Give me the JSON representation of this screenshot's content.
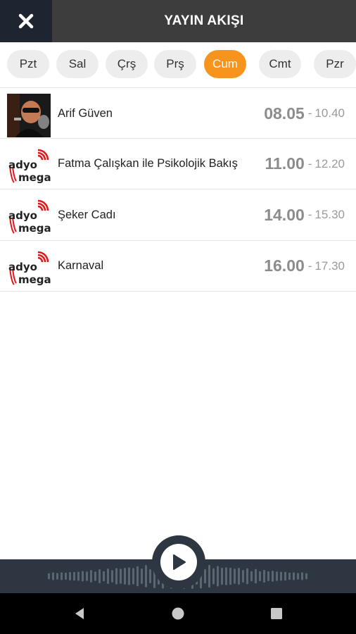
{
  "header": {
    "title": "YAYIN AKIŞI",
    "close_icon": "close-icon"
  },
  "days": [
    {
      "label": "Pzt",
      "active": false
    },
    {
      "label": "Sal",
      "active": false
    },
    {
      "label": "Çrş",
      "active": false
    },
    {
      "label": "Prş",
      "active": false
    },
    {
      "label": "Cum",
      "active": true
    },
    {
      "label": "Cmt",
      "active": false
    },
    {
      "label": "Pzr",
      "active": false
    }
  ],
  "schedule": [
    {
      "name": "Arif Güven",
      "start": "08.05",
      "end": "10.40",
      "thumb": "host-photo"
    },
    {
      "name": "Fatma Çalışkan ile Psikolojik Bakış",
      "start": "11.00",
      "end": "12.20",
      "thumb": "radyo-mega-logo"
    },
    {
      "name": "Şeker Cadı",
      "start": "14.00",
      "end": "15.30",
      "thumb": "radyo-mega-logo"
    },
    {
      "name": "Karnaval",
      "start": "16.00",
      "end": "17.30",
      "thumb": "radyo-mega-logo"
    }
  ],
  "time_separator": "-",
  "logo_text": "radyo mega",
  "colors": {
    "accent": "#f7941d",
    "header_bg": "#3d3d3d",
    "close_bg": "#1e2530",
    "player_bg": "#2d3641"
  },
  "player": {
    "play_icon": "play-icon"
  },
  "navigation": {
    "back": "back-icon",
    "home": "home-icon",
    "recents": "recents-icon"
  }
}
